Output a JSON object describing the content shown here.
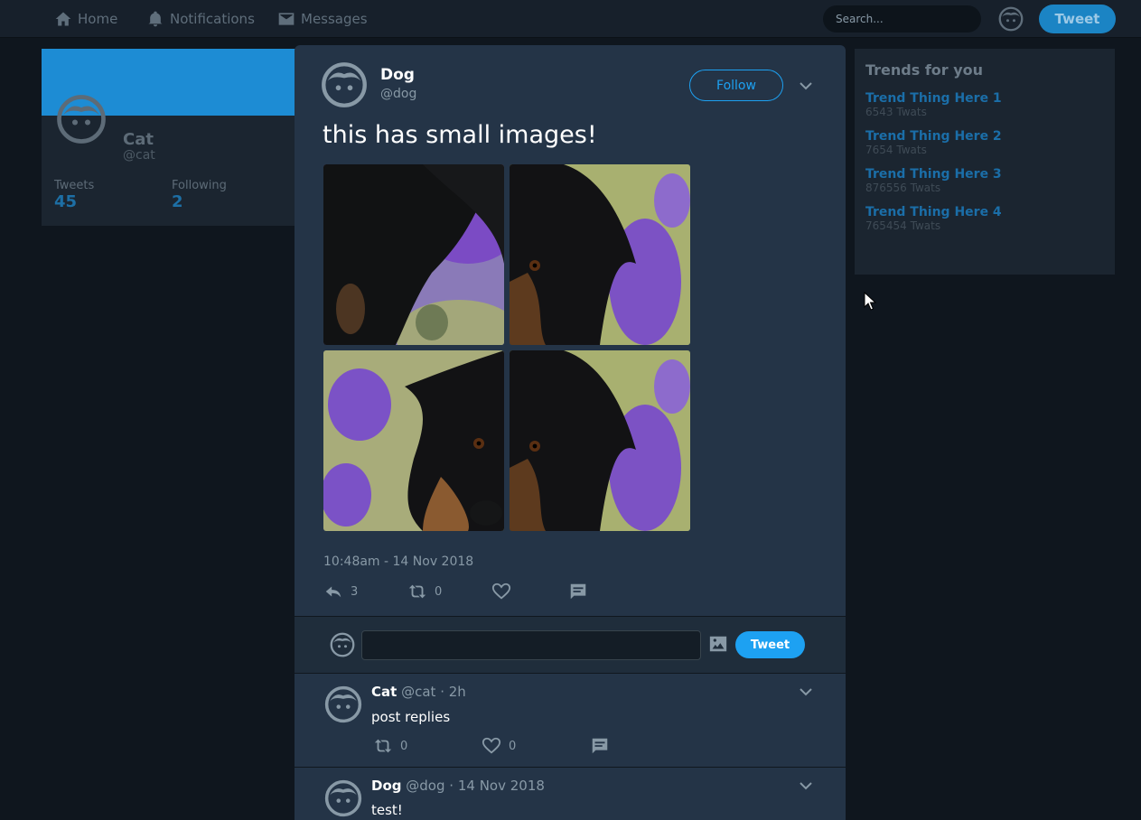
{
  "nav": {
    "home": "Home",
    "notifications": "Notifications",
    "messages": "Messages",
    "search_placeholder": "Search...",
    "tweet_button": "Tweet"
  },
  "profile": {
    "name": "Cat",
    "handle": "@cat",
    "tweets_label": "Tweets",
    "tweets_value": "45",
    "following_label": "Following",
    "following_value": "2"
  },
  "trends": {
    "title": "Trends for you",
    "items": [
      {
        "name": "Trend Thing Here 1",
        "count": "6543 Twats"
      },
      {
        "name": "Trend Thing Here 2",
        "count": "7654 Twats"
      },
      {
        "name": "Trend Thing Here 3",
        "count": "876556 Twats"
      },
      {
        "name": "Trend Thing Here 4",
        "count": "765454 Twats"
      }
    ]
  },
  "tweet": {
    "name": "Dog",
    "handle": "@dog",
    "follow_label": "Follow",
    "text": "this has small images!",
    "timestamp": "10:48am - 14 Nov 2018",
    "reply_count": "3",
    "retweet_count": "0"
  },
  "compose": {
    "input_value": "",
    "tweet_button": "Tweet"
  },
  "replies": [
    {
      "name": "Cat",
      "handle": "@cat",
      "time": "2h",
      "text": "post replies",
      "retweets": "0",
      "likes": "0"
    },
    {
      "name": "Dog",
      "handle": "@dog",
      "time": "14 Nov 2018",
      "text": "test!"
    }
  ],
  "colors": {
    "accent": "#1da1f2",
    "panel": "#243447",
    "background": "#0f161e"
  }
}
